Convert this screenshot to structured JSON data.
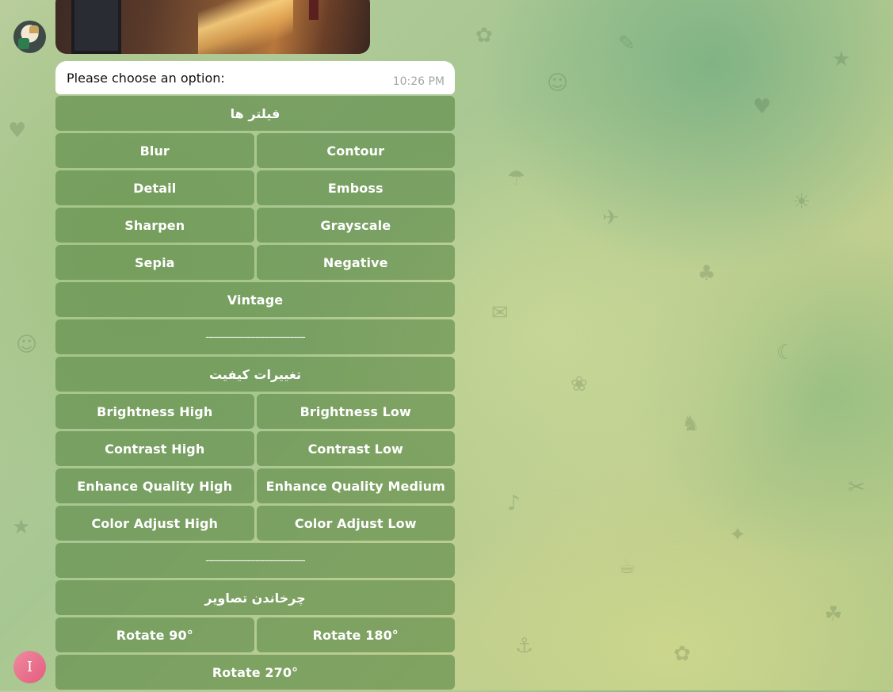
{
  "message": {
    "text": "Please choose an option:",
    "time": "10:26 PM"
  },
  "avatar_initial": "I",
  "keyboard": {
    "rows": [
      [
        "فیلتر ها"
      ],
      [
        "Blur",
        "Contour"
      ],
      [
        "Detail",
        "Emboss"
      ],
      [
        "Sharpen",
        "Grayscale"
      ],
      [
        "Sepia",
        "Negative"
      ],
      [
        "Vintage"
      ],
      [
        "----------------------------------"
      ],
      [
        "تغییرات کیفیت"
      ],
      [
        "Brightness High",
        "Brightness Low"
      ],
      [
        "Contrast High",
        "Contrast Low"
      ],
      [
        "Enhance Quality High",
        "Enhance Quality Medium"
      ],
      [
        "Color Adjust High",
        "Color Adjust Low"
      ],
      [
        "----------------------------------"
      ],
      [
        "چرخاندن تصاویر"
      ],
      [
        "Rotate 90°",
        "Rotate 180°"
      ],
      [
        "Rotate 270°"
      ]
    ]
  },
  "colors": {
    "button_bg": "#5a8746",
    "button_text": "#ffffff",
    "bubble_bg": "#ffffff",
    "time_text": "#a0aaa0",
    "fab_accent": "#e25d7e"
  },
  "icons": {
    "avatar": "user-avatar-icon",
    "photo": "image-thumbnail"
  }
}
